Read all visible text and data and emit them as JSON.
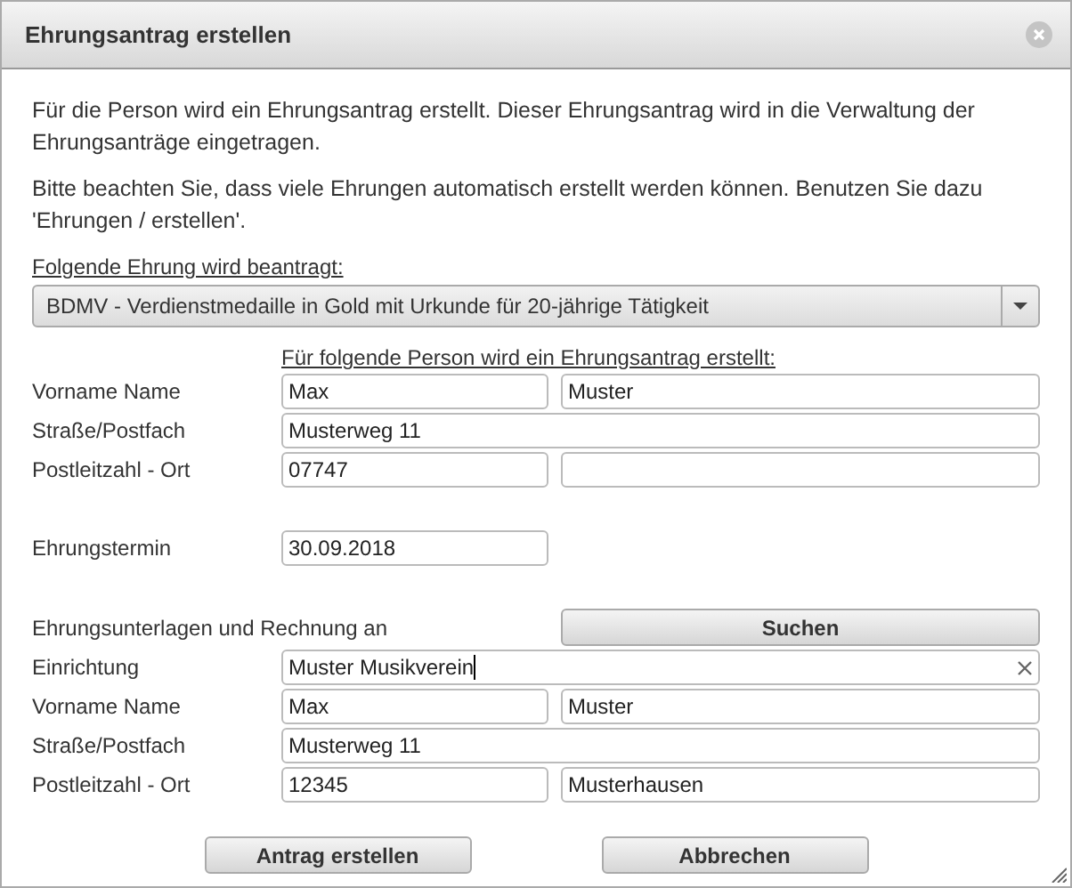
{
  "dialog": {
    "title": "Ehrungsantrag erstellen"
  },
  "intro": [
    "Für die Person wird ein Ehrungsantrag erstellt. Dieser Ehrungsantrag wird in die Verwaltung der Ehrungsanträge eingetragen.",
    "Bitte beachten Sie, dass viele Ehrungen automatisch erstellt werden können. Benutzen Sie dazu 'Ehrungen / erstellen'."
  ],
  "honor": {
    "label": "Folgende Ehrung wird beantragt:",
    "value": "BDMV - Verdienstmedaille in Gold mit Urkunde für 20-jährige Tätigkeit"
  },
  "person": {
    "heading": "Für folgende Person wird ein Ehrungsantrag erstellt:",
    "rows": [
      {
        "label": "Vorname Name",
        "kind": "pair",
        "values": [
          "Max",
          "Muster"
        ]
      },
      {
        "label": "Straße/Postfach",
        "kind": "single",
        "values": [
          "Musterweg 11"
        ]
      },
      {
        "label": "Postleitzahl - Ort",
        "kind": "pair",
        "values": [
          "07747"
        ]
      }
    ]
  },
  "date": {
    "label": "Ehrungstermin",
    "value": "30.09.2018"
  },
  "recipient": {
    "label": "Ehrungsunterlagen und Rechnung an",
    "search_button": "Suchen",
    "rows": [
      {
        "label": "Einrichtung",
        "kind": "clearable",
        "values": [
          "Muster Musikverein"
        ],
        "focused": true
      },
      {
        "label": "Vorname Name",
        "kind": "pair",
        "values": [
          "Max",
          "Muster"
        ]
      },
      {
        "label": "Straße/Postfach",
        "kind": "single",
        "values": [
          "Musterweg 11"
        ]
      },
      {
        "label": "Postleitzahl - Ort",
        "kind": "pair",
        "values": [
          "12345",
          "Musterhausen"
        ]
      }
    ]
  },
  "buttons": [
    "Antrag erstellen",
    "Abbrechen"
  ]
}
